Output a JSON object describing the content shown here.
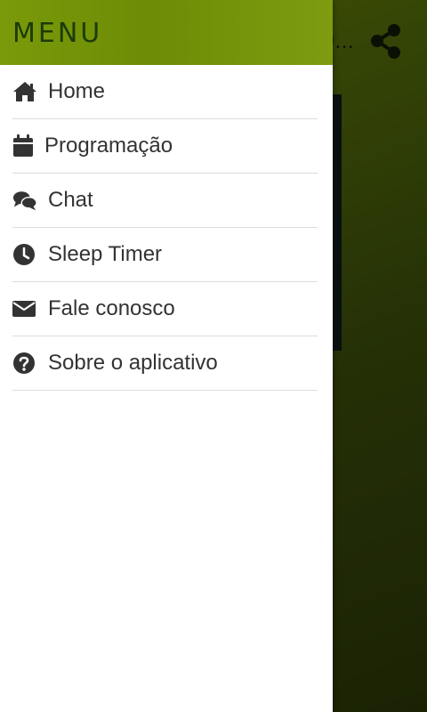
{
  "app": {
    "title_fragment": "O...",
    "share_icon": "share-icon",
    "colors": {
      "header_green": "#6d8c06",
      "drawer_title": "#1d3b0a",
      "menu_text": "#333333",
      "divider": "#dcdcdc"
    }
  },
  "drawer": {
    "title": "MENU",
    "items": [
      {
        "label": "Home",
        "icon": "home-icon"
      },
      {
        "label": "Programação",
        "icon": "calendar-icon"
      },
      {
        "label": "Chat",
        "icon": "chat-icon"
      },
      {
        "label": "Sleep Timer",
        "icon": "clock-icon"
      },
      {
        "label": "Fale conosco",
        "icon": "envelope-icon"
      },
      {
        "label": "Sobre o aplicativo",
        "icon": "question-circle-icon"
      }
    ]
  }
}
